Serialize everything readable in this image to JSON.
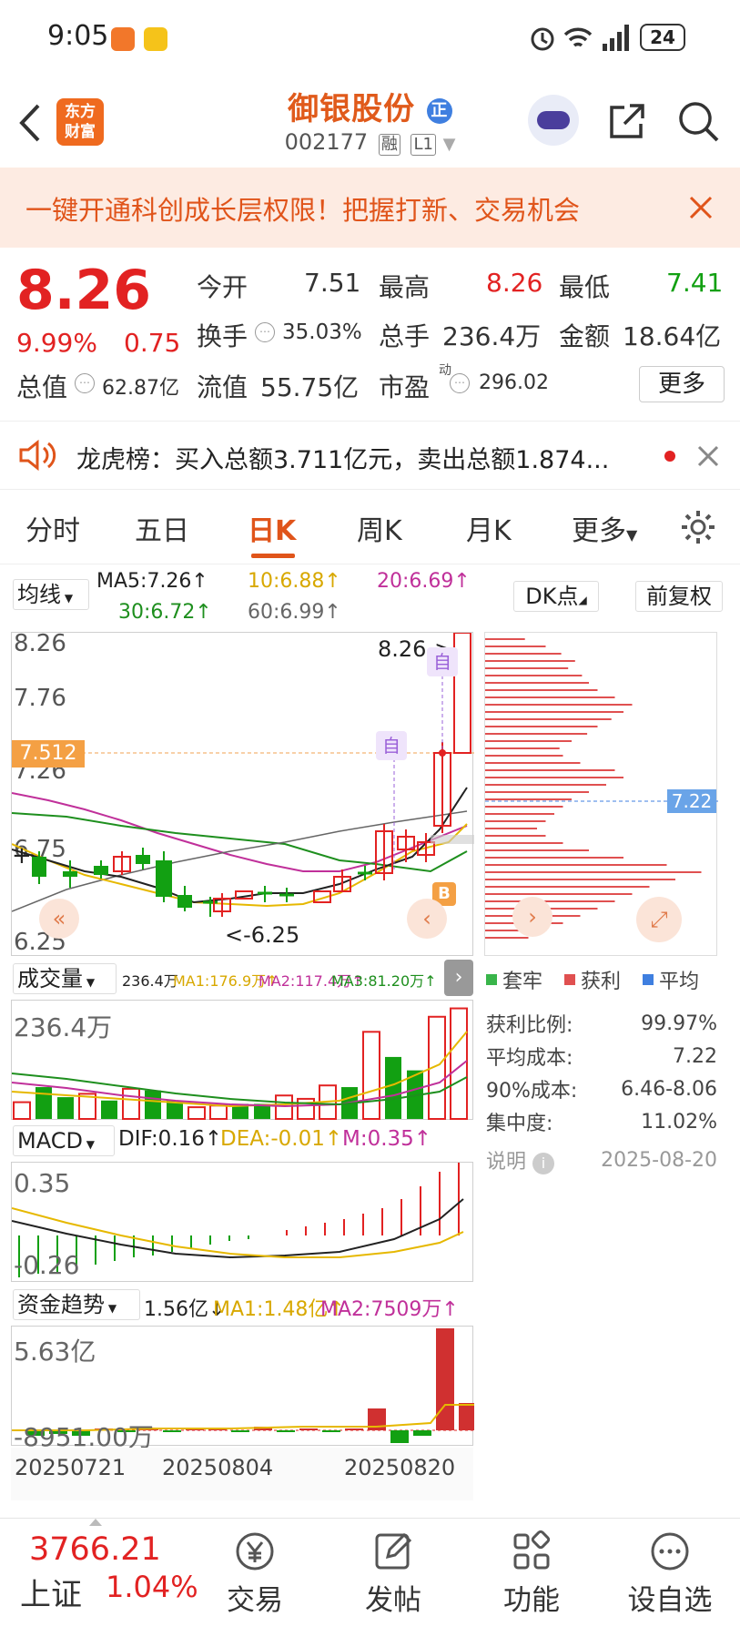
{
  "status": {
    "time": "9:05",
    "battery": "24"
  },
  "header": {
    "logo": "东方\n财富",
    "logo_line1": "东方",
    "logo_line2": "财富",
    "name": "御银股份",
    "name_badge": "正",
    "code": "002177",
    "tag_margin": "融",
    "tag_level": "L1"
  },
  "banner": {
    "text": "一键开通科创成长层权限！把握打新、交易机会"
  },
  "quote": {
    "price": "8.26",
    "change_pct": "9.99%",
    "change": "0.75",
    "open_label": "今开",
    "open": "7.51",
    "high_label": "最高",
    "high": "8.26",
    "low_label": "最低",
    "low": "7.41",
    "turnover_label": "换手",
    "turnover": "35.03%",
    "volume_label": "总手",
    "volume": "236.4万",
    "amount_label": "金额",
    "amount": "18.64亿",
    "mktcap_label": "总值",
    "mktcap": "62.87亿",
    "float_label": "流值",
    "float_cap": "55.75亿",
    "pe_label": "市盈",
    "pe_sup": "动",
    "pe": "296.02",
    "more_label": "更多"
  },
  "notice": {
    "text": "龙虎榜：买入总额3.711亿元，卖出总额1.874..."
  },
  "tabs": [
    "分时",
    "五日",
    "日K",
    "周K",
    "月K",
    "更多"
  ],
  "active_tab": "日K",
  "kline": {
    "ma_selector": "均线",
    "ma5": "MA5:7.26↑",
    "ma10": "10:6.88↑",
    "ma20": "20:6.69↑",
    "ma30": "30:6.72↑",
    "ma60": "60:6.99↑",
    "dk_label": "DK点",
    "adjust_label": "前复权",
    "y_labels": [
      "8.26",
      "7.76",
      "7.26",
      "6.75",
      "6.25"
    ],
    "current_marker": "7.512",
    "high_annot": "8.26->",
    "low_annot": "<-6.25",
    "self_tag": "自",
    "buy_tag": "B",
    "colors": {
      "up": "#e22222",
      "down": "#12a012",
      "ma5": "#222222",
      "ma10": "#e6b800",
      "ma20": "#c0309a",
      "ma30": "#1e8f1e",
      "ma60": "#888888"
    }
  },
  "chip": {
    "avg_label": "7.22",
    "legend": [
      "套牢",
      "获利",
      "平均"
    ],
    "profit_ratio_label": "获利比例:",
    "profit_ratio": "99.97%",
    "avg_cost_label": "平均成本:",
    "avg_cost": "7.22",
    "cost90_label": "90%成本:",
    "cost90": "6.46-8.06",
    "concentration_label": "集中度:",
    "concentration": "11.02%",
    "note_label": "说明",
    "date": "2025-08-20"
  },
  "volume": {
    "selector": "成交量",
    "value": "236.4万",
    "ma1": "MA1:176.9万↑",
    "ma2": "MA2:117.4万↑",
    "ma3": "MA3:81.20万↑",
    "max_label": "236.4万"
  },
  "macd": {
    "selector": "MACD",
    "dif": "DIF:0.16↑",
    "dea": "DEA:-0.01↑",
    "m": "M:0.35↑",
    "top_label": "0.35",
    "bottom_label": "-0.26"
  },
  "fund": {
    "selector": "资金趋势",
    "value": "1.56亿↓",
    "ma1": "MA1:1.48亿↑",
    "ma2": "MA2:7509万↑",
    "top_label": "5.63亿",
    "bottom_label": "-8951.00万"
  },
  "dates": [
    "20250721",
    "20250804",
    "20250820"
  ],
  "bottom_nav": {
    "index_value": "3766.21",
    "index_name": "上证",
    "index_change": "1.04%",
    "items": [
      "交易",
      "发帖",
      "功能",
      "设自选"
    ]
  }
}
